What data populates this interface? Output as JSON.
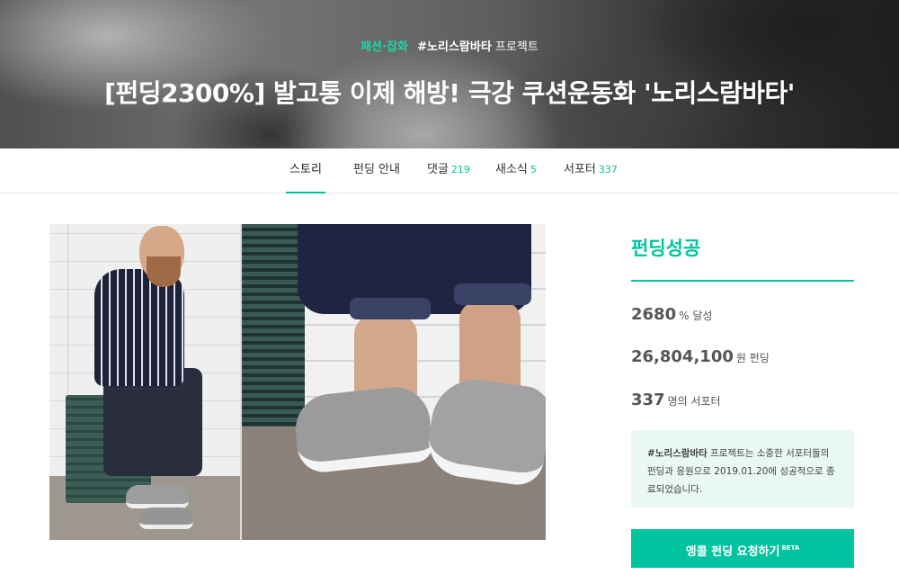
{
  "hero": {
    "category": "패션·잡화",
    "maker": "#노리스람바타",
    "maker_suffix": "프로젝트",
    "title": "[펀딩2300%] 발고통 이제 해방! 극강 쿠션운동화 '노리스람바타'"
  },
  "tabs": [
    {
      "label": "스토리",
      "count": ""
    },
    {
      "label": "펀딩 안내",
      "count": ""
    },
    {
      "label": "댓글",
      "count": "219"
    },
    {
      "label": "새소식",
      "count": "5"
    },
    {
      "label": "서포터",
      "count": "337"
    }
  ],
  "side": {
    "status": "펀딩성공",
    "stats": [
      {
        "value": "2680",
        "unit": "% 달성"
      },
      {
        "value": "26,804,100",
        "unit": "원 펀딩"
      },
      {
        "value": "337",
        "unit": "명의 서포터"
      }
    ],
    "notice": {
      "maker": "#노리스람바타",
      "text": "프로젝트는 소중한 서포터들의 펀딩과 응원으로 2019.01.20에 성공적으로 종료되었습니다."
    },
    "request_button": {
      "label": "앵콜 펀딩 요청하기",
      "badge": "BETA"
    }
  },
  "colors": {
    "accent": "#00c4a0",
    "notice_bg": "#eaf8f4"
  }
}
